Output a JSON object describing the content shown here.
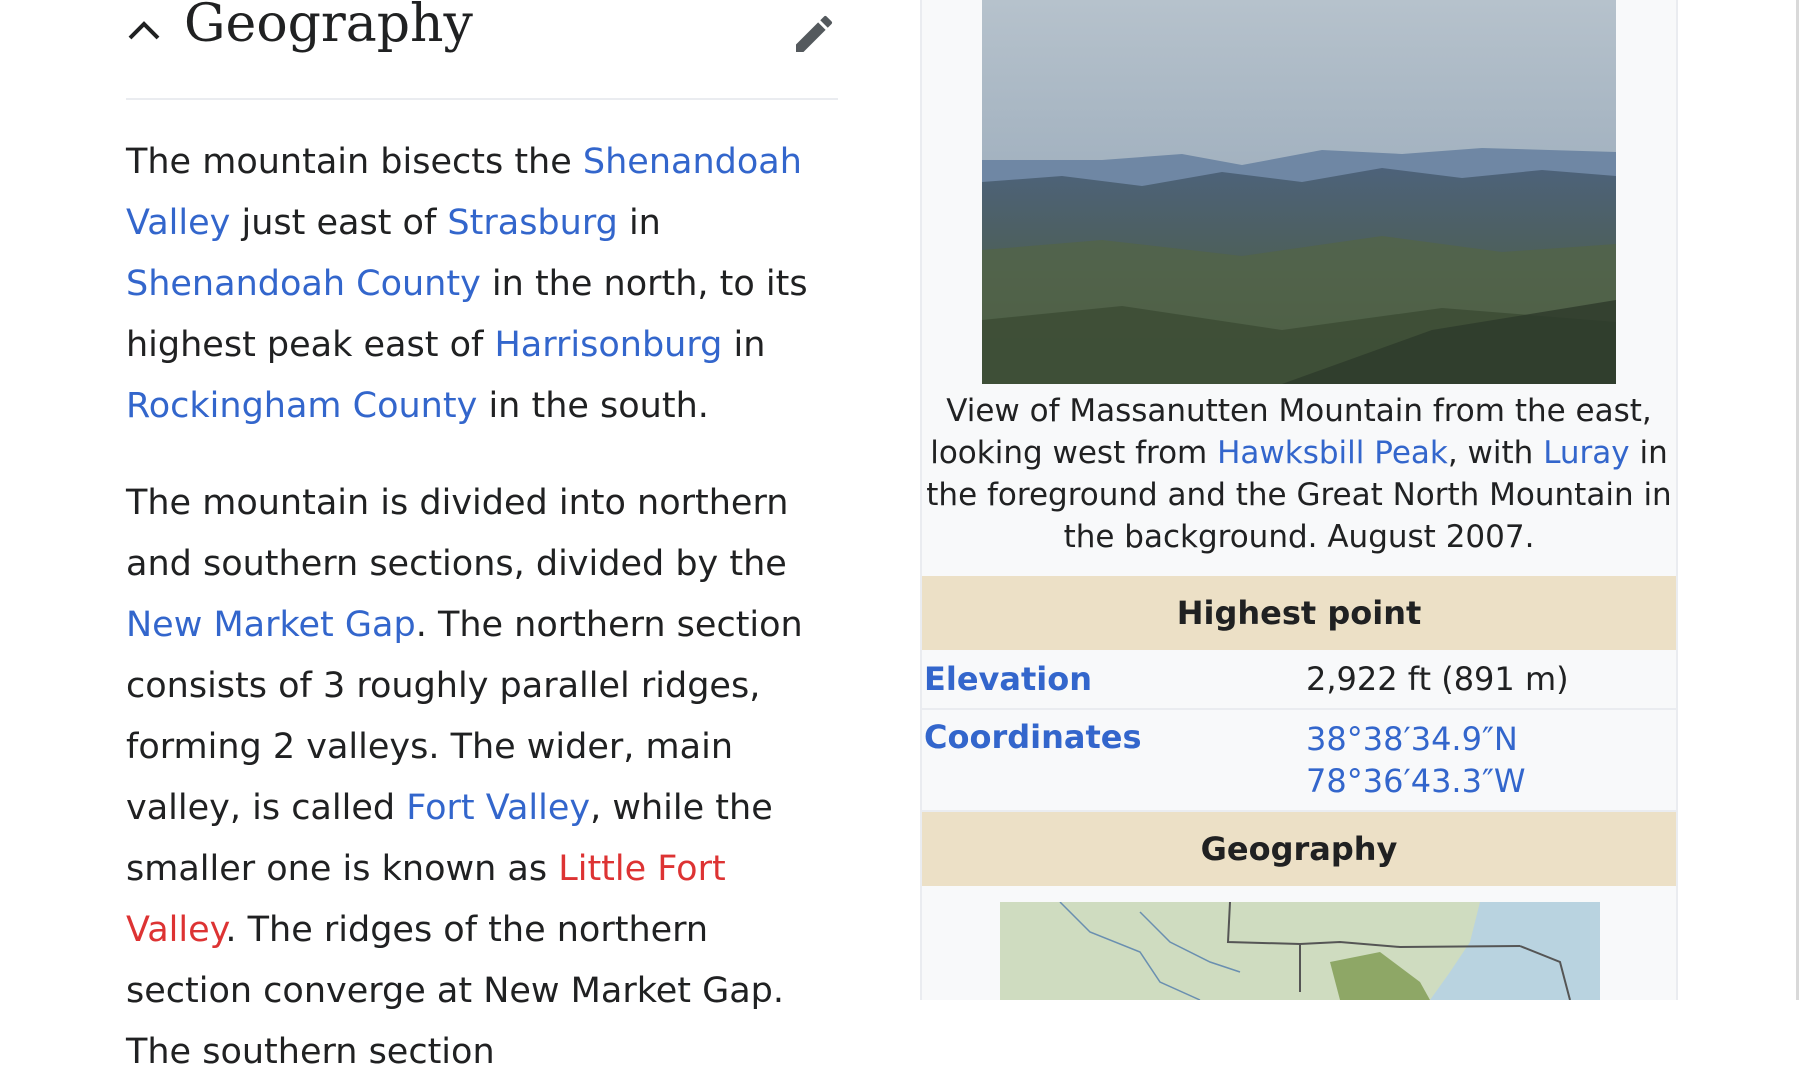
{
  "section": {
    "title": "Geography"
  },
  "paragraph1": {
    "t1": "The mountain bisects the ",
    "link_shenandoah_valley": "Shenandoah Valley",
    "t2": " just east of ",
    "link_strasburg": "Strasburg",
    "t3": " in ",
    "link_shenandoah_county": "Shenandoah County",
    "t4": " in the north, to its highest peak east of ",
    "link_harrisonburg": "Harrisonburg",
    "t5": " in ",
    "link_rockingham_county": "Rockingham County",
    "t6": " in the south."
  },
  "paragraph2": {
    "t1": "The mountain is divided into northern and southern sections, divided by the ",
    "link_new_market_gap": "New Market Gap",
    "t2": ". The northern section consists of 3 roughly parallel ridges, forming 2 valleys. The wider, main valley, is called ",
    "link_fort_valley": "Fort Valley",
    "t3": ", while the smaller one is known as ",
    "link_little_fort_valley": "Little Fort Valley",
    "t4": ". The ridges of the northern section converge at New Market Gap. The southern section"
  },
  "infobox": {
    "caption": {
      "t1": "View of Massanutten Mountain from the east, looking west from ",
      "link_hawksbill": "Hawksbill Peak",
      "t2": ", with ",
      "link_luray": "Luray",
      "t3": " in the foreground and the Great North Mountain in the background. August 2007."
    },
    "highest_point_header": "Highest point",
    "elevation_label": "Elevation",
    "elevation_value": "2,922 ft (891 m)",
    "coordinates_label": "Coordinates",
    "coordinates_lat": "38°38′34.9″N",
    "coordinates_lon": "78°36′43.3″W",
    "geography_header": "Geography"
  },
  "icons": {
    "collapse": "chevron-up-icon",
    "edit": "pencil-icon"
  },
  "colors": {
    "link": "#3366cc",
    "red_link": "#d33333",
    "infobox_header": "#ece0c6",
    "infobox_bg": "#f8f9fa"
  }
}
